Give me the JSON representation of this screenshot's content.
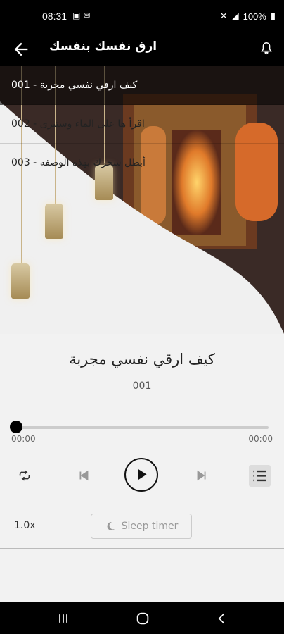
{
  "status_bar": {
    "time": "08:31",
    "battery": "100%"
  },
  "app_bar": {
    "title": "ارق نفسك بنفسك"
  },
  "playlist": [
    {
      "label": "001 - كيف ارقي نفسي مجربة",
      "active": true
    },
    {
      "label": "002 - اقرأ ها على الماء وستبرى",
      "active": false
    },
    {
      "label": "003 - أبطل سحرك بهذه الوصفة",
      "active": false
    }
  ],
  "player": {
    "title": "كيف ارقي نفسي مجربة",
    "number": "001",
    "position": "00:00",
    "duration": "00:00",
    "progress": 0,
    "speed": "1.0x",
    "sleep_label": "Sleep timer"
  },
  "icons": {
    "back": "arrow-left-icon",
    "bell": "notification-bell-icon",
    "repeat": "repeat-icon",
    "prev": "skip-previous-icon",
    "play": "play-icon",
    "next": "skip-next-icon",
    "queue": "queue-list-icon",
    "moon": "moon-icon"
  }
}
